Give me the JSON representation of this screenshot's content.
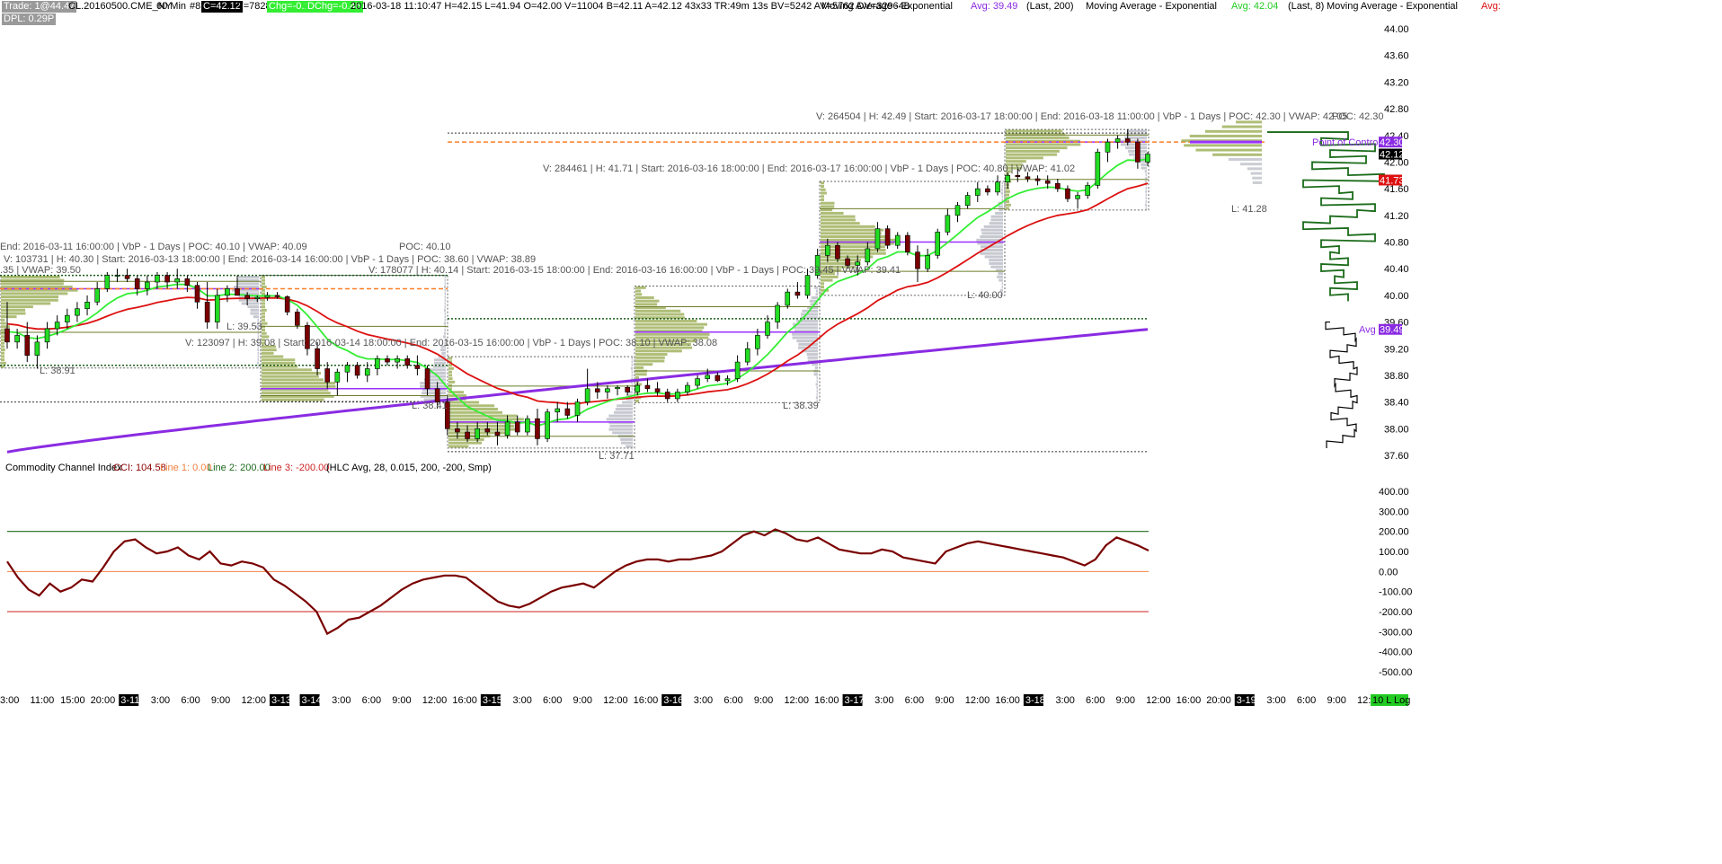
{
  "header": {
    "trade_badge": "Trade: 1@44.47",
    "symbol": "CL.20160500.CME_NY",
    "interval": "60 Min",
    "bar_no": "#8",
    "close": "C=42.12",
    "ticks": "T=7828",
    "chg": "Chg=-0.11",
    "dchg": "DChg=-0.46",
    "stats": "2016-03-18 11:10:47 H=42.15 L=41.94 O=42.00 V=11004 B=42.11 A=42.12 43x33 TR:49m 13s BV=5242 AV=5762 DV=329648",
    "ma1_name": "Moving Average - Exponential",
    "ma1_avg": "Avg: 39.49",
    "ma1_params": "(Last, 200)",
    "ma2_name": "Moving Average - Exponential",
    "ma2_avg": "Avg: 42.04",
    "ma2_params": "(Last, 8)",
    "ma3_name": "Moving Average - Exponential",
    "ma3_avg": "Avg:",
    "dpl_badge": "DPL: 0.29P"
  },
  "colors": {
    "up_candle": "#22dd22",
    "down_candle": "#7a0000",
    "ema200": "#8a2be2",
    "ema8": "#33ee33",
    "ema21": "#dd1111",
    "vbp": "#93a84a",
    "vbp_gray": "#b9bcc5",
    "cci": "#7a0000",
    "cci_line1": "#f08040",
    "cci_line2": "#1d6b1d",
    "cci_line3": "#cc2222"
  },
  "vbp_labels": [
    {
      "text": "End: 2016-03-11  16:00:00 | VbP - 1 Days | POC: 40.10 | VWAP: 40.09"
    },
    {
      "text": "V: 103731 | H: 40.30 | Start: 2016-03-13  18:00:00 | End: 2016-03-14  16:00:00 | VbP - 1 Days | POC: 38.60 | VWAP: 38.89"
    },
    {
      "text": ".35 | VWAP: 39.50"
    },
    {
      "text": "POC: 40.10"
    },
    {
      "text": "V: 178077 | H: 40.14 | Start: 2016-03-15  18:00:00 | End: 2016-03-16  16:00:00 | VbP - 1 Days | POC: 39.45 | VWAP: 39.41"
    },
    {
      "text": "V: 123097 | H: 39.08 | Start: 2016-03-14  18:00:00 | End: 2016-03-15  16:00:00 | VbP - 1 Days | POC: 38.10 | VWAP: 38.08"
    },
    {
      "text": "V: 284461 | H: 41.71 | Start: 2016-03-16  18:00:00 | End: 2016-03-17  16:00:00 | VbP - 1 Days | POC: 40.80 | VWAP: 41.02"
    },
    {
      "text": "V: 264504 | H: 42.49 | Start: 2016-03-17  18:00:00 | End: 2016-03-18  11:00:00 | VbP - 1 Days | POC: 42.30 | VWAP: 42.05"
    },
    {
      "text": "POC: 42.30"
    }
  ],
  "low_labels": [
    "L: 38.91",
    "L: 39.53",
    "L: 38.41",
    "L: 37.71",
    "L: 38.39",
    "L: 40.00",
    "L: 41.28"
  ],
  "price_tags": {
    "poc": "42.30",
    "last": "42.12",
    "ema21": "41.73",
    "ema200": "39.49",
    "poc_text": "Point of Control",
    "avg_text": "Avg"
  },
  "cci_header": {
    "name": "Commodity Channel Index",
    "cci": "CCI: 104.58",
    "line1": "Line 1: 0.00",
    "line2": "Line 2: 200.00",
    "line3": "Line 3: -200.00",
    "params": "(HLC Avg, 28, 0.015, 200, -200, Smp)"
  },
  "footer": {
    "log_badge": "10 L Log"
  },
  "chart_data": [
    {
      "type": "candlestick",
      "title": "CL.20160500.CME_NY 60 Min",
      "y_axis_side": "right",
      "ylim": [
        37.6,
        44.0
      ],
      "y_ticks": [
        "44.00",
        "43.60",
        "43.20",
        "42.80",
        "42.40",
        "42.00",
        "41.60",
        "41.20",
        "40.80",
        "40.40",
        "40.00",
        "39.60",
        "39.20",
        "38.80",
        "38.40",
        "38.00",
        "37.60"
      ],
      "candles": [
        [
          39.5,
          39.9,
          39.2,
          39.3
        ],
        [
          39.3,
          39.5,
          39.2,
          39.4
        ],
        [
          39.4,
          39.6,
          39.0,
          39.1
        ],
        [
          39.1,
          39.4,
          38.9,
          39.3
        ],
        [
          39.3,
          39.6,
          39.2,
          39.5
        ],
        [
          39.5,
          39.7,
          39.4,
          39.6
        ],
        [
          39.6,
          39.8,
          39.5,
          39.7
        ],
        [
          39.7,
          39.9,
          39.6,
          39.8
        ],
        [
          39.8,
          40.0,
          39.7,
          39.9
        ],
        [
          39.9,
          40.2,
          39.85,
          40.1
        ],
        [
          40.1,
          40.35,
          40.05,
          40.3
        ],
        [
          40.3,
          40.4,
          40.2,
          40.3
        ],
        [
          40.3,
          40.4,
          40.2,
          40.25
        ],
        [
          40.25,
          40.3,
          40.0,
          40.1
        ],
        [
          40.1,
          40.3,
          40.0,
          40.2
        ],
        [
          40.2,
          40.35,
          40.1,
          40.3
        ],
        [
          40.3,
          40.35,
          40.1,
          40.2
        ],
        [
          40.2,
          40.4,
          40.1,
          40.25
        ],
        [
          40.25,
          40.3,
          40.05,
          40.15
        ],
        [
          40.15,
          40.2,
          39.8,
          39.9
        ],
        [
          39.9,
          40.2,
          39.5,
          39.6
        ],
        [
          39.6,
          40.1,
          39.5,
          40.0
        ],
        [
          40.0,
          40.15,
          39.9,
          40.1
        ],
        [
          40.1,
          40.3,
          40.0,
          40.0
        ],
        [
          40.0,
          40.05,
          39.85,
          39.95
        ],
        [
          39.95,
          40.0,
          39.9,
          39.97
        ],
        [
          39.97,
          40.05,
          39.92,
          40.0
        ],
        [
          40.0,
          40.05,
          39.95,
          39.98
        ],
        [
          39.98,
          40.0,
          39.7,
          39.75
        ],
        [
          39.75,
          39.8,
          39.5,
          39.55
        ],
        [
          39.55,
          39.6,
          39.1,
          39.2
        ],
        [
          39.2,
          39.3,
          38.8,
          38.9
        ],
        [
          38.9,
          39.0,
          38.6,
          38.7
        ],
        [
          38.7,
          38.9,
          38.5,
          38.85
        ],
        [
          38.85,
          39.0,
          38.7,
          38.95
        ],
        [
          38.95,
          39.0,
          38.75,
          38.8
        ],
        [
          38.8,
          39.0,
          38.7,
          38.9
        ],
        [
          38.9,
          39.1,
          38.8,
          39.05
        ],
        [
          39.05,
          39.1,
          38.95,
          39.0
        ],
        [
          39.0,
          39.1,
          38.9,
          39.05
        ],
        [
          39.05,
          39.1,
          38.9,
          38.95
        ],
        [
          38.95,
          39.1,
          38.8,
          38.9
        ],
        [
          38.9,
          38.95,
          38.5,
          38.6
        ],
        [
          38.6,
          38.7,
          38.3,
          38.4
        ],
        [
          38.4,
          38.5,
          37.9,
          38.0
        ],
        [
          38.0,
          38.1,
          37.85,
          37.95
        ],
        [
          37.95,
          38.05,
          37.8,
          37.85
        ],
        [
          37.85,
          38.1,
          37.8,
          38.0
        ],
        [
          38.0,
          38.1,
          37.9,
          37.95
        ],
        [
          37.95,
          38.1,
          37.75,
          37.9
        ],
        [
          37.9,
          38.2,
          37.85,
          38.1
        ],
        [
          38.1,
          38.2,
          37.9,
          37.95
        ],
        [
          37.95,
          38.2,
          37.9,
          38.15
        ],
        [
          38.15,
          38.3,
          37.75,
          37.85
        ],
        [
          37.85,
          38.3,
          37.8,
          38.25
        ],
        [
          38.25,
          38.4,
          38.1,
          38.3
        ],
        [
          38.3,
          38.4,
          38.15,
          38.2
        ],
        [
          38.2,
          38.45,
          38.1,
          38.4
        ],
        [
          38.4,
          38.9,
          38.35,
          38.6
        ],
        [
          38.6,
          38.7,
          38.45,
          38.55
        ],
        [
          38.55,
          38.65,
          38.45,
          38.6
        ],
        [
          38.6,
          38.65,
          38.5,
          38.62
        ],
        [
          38.62,
          38.65,
          38.5,
          38.55
        ],
        [
          38.55,
          38.7,
          38.5,
          38.65
        ],
        [
          38.65,
          38.75,
          38.55,
          38.6
        ],
        [
          38.6,
          38.7,
          38.5,
          38.55
        ],
        [
          38.55,
          38.6,
          38.4,
          38.45
        ],
        [
          38.45,
          38.6,
          38.4,
          38.55
        ],
        [
          38.55,
          38.7,
          38.5,
          38.65
        ],
        [
          38.65,
          38.8,
          38.6,
          38.75
        ],
        [
          38.75,
          38.9,
          38.7,
          38.8
        ],
        [
          38.8,
          38.85,
          38.7,
          38.72
        ],
        [
          38.72,
          38.8,
          38.65,
          38.75
        ],
        [
          38.75,
          39.1,
          38.7,
          39.0
        ],
        [
          39.0,
          39.3,
          38.95,
          39.2
        ],
        [
          39.2,
          39.5,
          39.1,
          39.4
        ],
        [
          39.4,
          39.7,
          39.35,
          39.6
        ],
        [
          39.6,
          39.9,
          39.5,
          39.85
        ],
        [
          39.85,
          40.1,
          39.8,
          40.05
        ],
        [
          40.05,
          40.2,
          39.95,
          40.0
        ],
        [
          40.0,
          40.4,
          39.95,
          40.3
        ],
        [
          40.3,
          40.7,
          40.25,
          40.6
        ],
        [
          40.6,
          40.85,
          40.5,
          40.75
        ],
        [
          40.75,
          40.8,
          40.5,
          40.55
        ],
        [
          40.55,
          40.6,
          40.4,
          40.45
        ],
        [
          40.45,
          40.6,
          40.3,
          40.5
        ],
        [
          40.5,
          40.8,
          40.45,
          40.7
        ],
        [
          40.7,
          41.1,
          40.65,
          41.0
        ],
        [
          41.0,
          41.05,
          40.7,
          40.75
        ],
        [
          40.75,
          40.95,
          40.7,
          40.9
        ],
        [
          40.9,
          40.95,
          40.6,
          40.65
        ],
        [
          40.65,
          40.75,
          40.2,
          40.4
        ],
        [
          40.4,
          40.7,
          40.35,
          40.6
        ],
        [
          40.6,
          41.0,
          40.55,
          40.95
        ],
        [
          40.95,
          41.3,
          40.9,
          41.2
        ],
        [
          41.2,
          41.4,
          41.1,
          41.35
        ],
        [
          41.35,
          41.55,
          41.3,
          41.5
        ],
        [
          41.5,
          41.7,
          41.4,
          41.6
        ],
        [
          41.6,
          41.65,
          41.5,
          41.55
        ],
        [
          41.55,
          41.8,
          41.5,
          41.7
        ],
        [
          41.7,
          41.85,
          41.6,
          41.8
        ],
        [
          41.8,
          41.9,
          41.7,
          41.78
        ],
        [
          41.78,
          41.85,
          41.7,
          41.75
        ],
        [
          41.75,
          41.8,
          41.65,
          41.72
        ],
        [
          41.72,
          41.8,
          41.6,
          41.68
        ],
        [
          41.68,
          41.75,
          41.55,
          41.6
        ],
        [
          41.6,
          41.65,
          41.4,
          41.45
        ],
        [
          41.45,
          41.55,
          41.3,
          41.5
        ],
        [
          41.5,
          41.7,
          41.45,
          41.65
        ],
        [
          41.65,
          42.2,
          41.6,
          42.15
        ],
        [
          42.15,
          42.35,
          42.0,
          42.3
        ],
        [
          42.3,
          42.4,
          42.2,
          42.35
        ],
        [
          42.35,
          42.49,
          42.25,
          42.3
        ],
        [
          42.3,
          42.35,
          41.9,
          42.0
        ],
        [
          42.0,
          42.15,
          41.94,
          42.12
        ]
      ],
      "series": [
        {
          "name": "Moving Average - Exponential (Last, 200)",
          "last": 39.49
        },
        {
          "name": "Moving Average - Exponential (Last, 8)",
          "last": 42.04
        },
        {
          "name": "Moving Average - Exponential",
          "last": 41.73
        }
      ],
      "value_area_levels": {
        "upper_dotted": 39.65,
        "lower_dotted": 38.95,
        "session_bottom": 37.71,
        "session_top": 42.49
      }
    },
    {
      "type": "line",
      "title": "Commodity Channel Index",
      "y_axis_side": "right",
      "ylim": [
        -500,
        400
      ],
      "y_ticks": [
        "400.00",
        "300.00",
        "200.00",
        "100.00",
        "0.00",
        "-100.00",
        "-200.00",
        "-300.00",
        "-400.00",
        "-500.00"
      ],
      "reference_lines": [
        0,
        200,
        -200
      ],
      "values": [
        50,
        -30,
        -90,
        -120,
        -60,
        -100,
        -80,
        -40,
        -50,
        20,
        100,
        150,
        160,
        120,
        90,
        100,
        120,
        80,
        60,
        100,
        40,
        30,
        50,
        40,
        20,
        -40,
        -70,
        -110,
        -150,
        -200,
        -310,
        -280,
        -240,
        -230,
        -200,
        -170,
        -130,
        -90,
        -60,
        -40,
        -30,
        -20,
        -20,
        -30,
        -70,
        -110,
        -150,
        -170,
        -180,
        -160,
        -130,
        -100,
        -80,
        -70,
        -60,
        -80,
        -40,
        0,
        30,
        50,
        60,
        60,
        50,
        60,
        60,
        70,
        80,
        100,
        140,
        180,
        200,
        180,
        210,
        190,
        160,
        150,
        170,
        140,
        110,
        100,
        90,
        90,
        110,
        100,
        70,
        60,
        50,
        40,
        100,
        120,
        140,
        150,
        140,
        130,
        120,
        110,
        100,
        90,
        80,
        70,
        50,
        30,
        60,
        130,
        170,
        150,
        130,
        104.58
      ]
    }
  ],
  "x_axis": {
    "ticks": [
      {
        "label": "3:00",
        "badge": false
      },
      {
        "label": "11:00",
        "badge": false
      },
      {
        "label": "15:00",
        "badge": false
      },
      {
        "label": "20:00",
        "badge": false
      },
      {
        "label": "3-11",
        "badge": true
      },
      {
        "label": "3:00",
        "badge": false
      },
      {
        "label": "6:00",
        "badge": false
      },
      {
        "label": "9:00",
        "badge": false
      },
      {
        "label": "12:00",
        "badge": false
      },
      {
        "label": "3-13",
        "badge": true
      },
      {
        "label": "3-14",
        "badge": true
      },
      {
        "label": "3:00",
        "badge": false
      },
      {
        "label": "6:00",
        "badge": false
      },
      {
        "label": "9:00",
        "badge": false
      },
      {
        "label": "12:00",
        "badge": false
      },
      {
        "label": "16:00",
        "badge": false
      },
      {
        "label": "3-15",
        "badge": true
      },
      {
        "label": "3:00",
        "badge": false
      },
      {
        "label": "6:00",
        "badge": false
      },
      {
        "label": "9:00",
        "badge": false
      },
      {
        "label": "12:00",
        "badge": false
      },
      {
        "label": "16:00",
        "badge": false
      },
      {
        "label": "3-16",
        "badge": true
      },
      {
        "label": "3:00",
        "badge": false
      },
      {
        "label": "6:00",
        "badge": false
      },
      {
        "label": "9:00",
        "badge": false
      },
      {
        "label": "12:00",
        "badge": false
      },
      {
        "label": "16:00",
        "badge": false
      },
      {
        "label": "3-17",
        "badge": true
      },
      {
        "label": "3:00",
        "badge": false
      },
      {
        "label": "6:00",
        "badge": false
      },
      {
        "label": "9:00",
        "badge": false
      },
      {
        "label": "12:00",
        "badge": false
      },
      {
        "label": "16:00",
        "badge": false
      },
      {
        "label": "3-18",
        "badge": true
      },
      {
        "label": "3:00",
        "badge": false
      },
      {
        "label": "6:00",
        "badge": false
      },
      {
        "label": "9:00",
        "badge": false
      },
      {
        "label": "12:00",
        "badge": false
      },
      {
        "label": "16:00",
        "badge": false
      },
      {
        "label": "20:00",
        "badge": false
      },
      {
        "label": "3-19",
        "badge": true
      },
      {
        "label": "3:00",
        "badge": false
      },
      {
        "label": "6:00",
        "badge": false
      },
      {
        "label": "9:00",
        "badge": false
      },
      {
        "label": "12:00",
        "badge": false
      }
    ]
  }
}
